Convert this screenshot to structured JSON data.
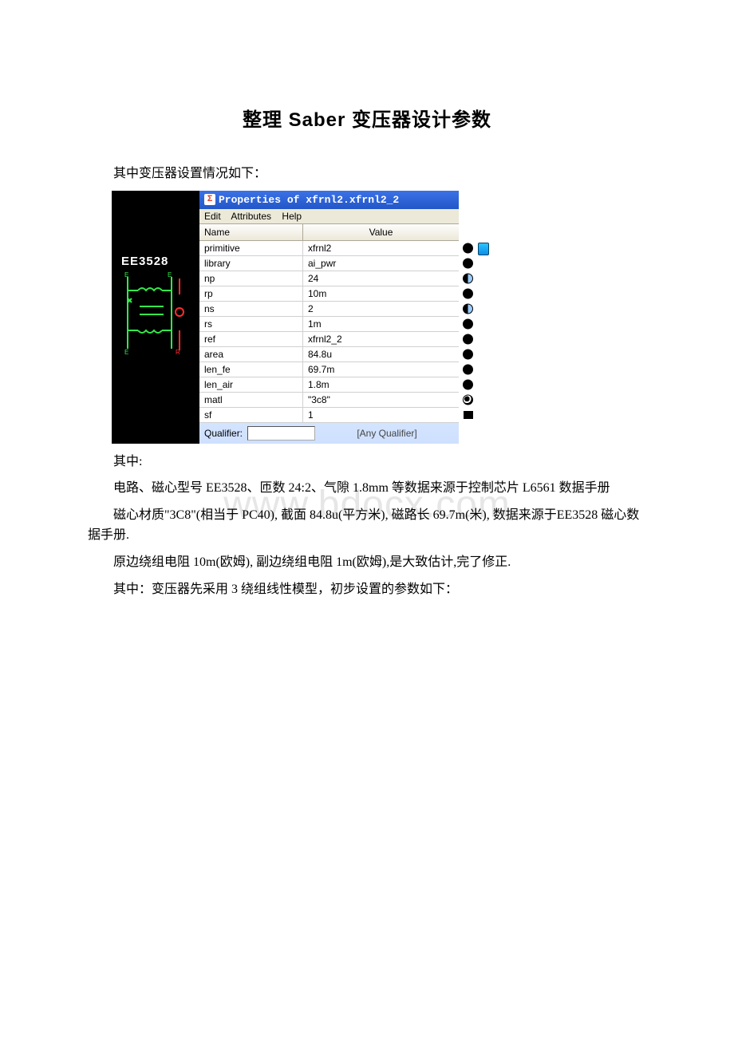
{
  "title": "整理 Saber 变压器设计参数",
  "intro": "其中变压器设置情况如下：",
  "watermark": "www.bdocx.com",
  "figure": {
    "schematicLabel": "EE3528",
    "windowTitle": "Properties of xfrnl2.xfrnl2_2",
    "menu": {
      "edit": "Edit",
      "attributes": "Attributes",
      "help": "Help"
    },
    "header": {
      "name": "Name",
      "value": "Value"
    },
    "rows": [
      {
        "name": "primitive",
        "value": "xfrnl2",
        "dot": "black",
        "extra": true
      },
      {
        "name": "library",
        "value": "ai_pwr",
        "dot": "black"
      },
      {
        "name": "np",
        "value": "24",
        "dot": "half"
      },
      {
        "name": "rp",
        "value": "10m",
        "dot": "black"
      },
      {
        "name": "ns",
        "value": "2",
        "dot": "half"
      },
      {
        "name": "rs",
        "value": "1m",
        "dot": "black"
      },
      {
        "name": "ref",
        "value": "xfrnl2_2",
        "dot": "black"
      },
      {
        "name": "area",
        "value": "84.8u",
        "dot": "black"
      },
      {
        "name": "len_fe",
        "value": "69.7m",
        "dot": "black"
      },
      {
        "name": "len_air",
        "value": "1.8m",
        "dot": "black"
      },
      {
        "name": "matl",
        "value": "\"3c8\"",
        "dot": "swirl"
      },
      {
        "name": "sf",
        "value": "1",
        "dot": "sq"
      }
    ],
    "qualifier": {
      "label": "Qualifier:",
      "any": "[Any Qualifier]"
    }
  },
  "paras": {
    "p1": "其中:",
    "p2": "电路、磁心型号 EE3528、匝数 24:2、气隙 1.8mm 等数据来源于控制芯片 L6561 数据手册",
    "p3": "磁心材质\"3C8\"(相当于 PC40), 截面 84.8u(平方米), 磁路长 69.7m(米), 数据来源于EE3528 磁心数据手册.",
    "p4": "原边绕组电阻 10m(欧姆), 副边绕组电阻 1m(欧姆),是大致估计,完了修正.",
    "p5": "其中：变压器先采用 3 绕组线性模型，初步设置的参数如下："
  },
  "colors": {
    "green": "#32e84a",
    "red": "#ff2d2d"
  }
}
